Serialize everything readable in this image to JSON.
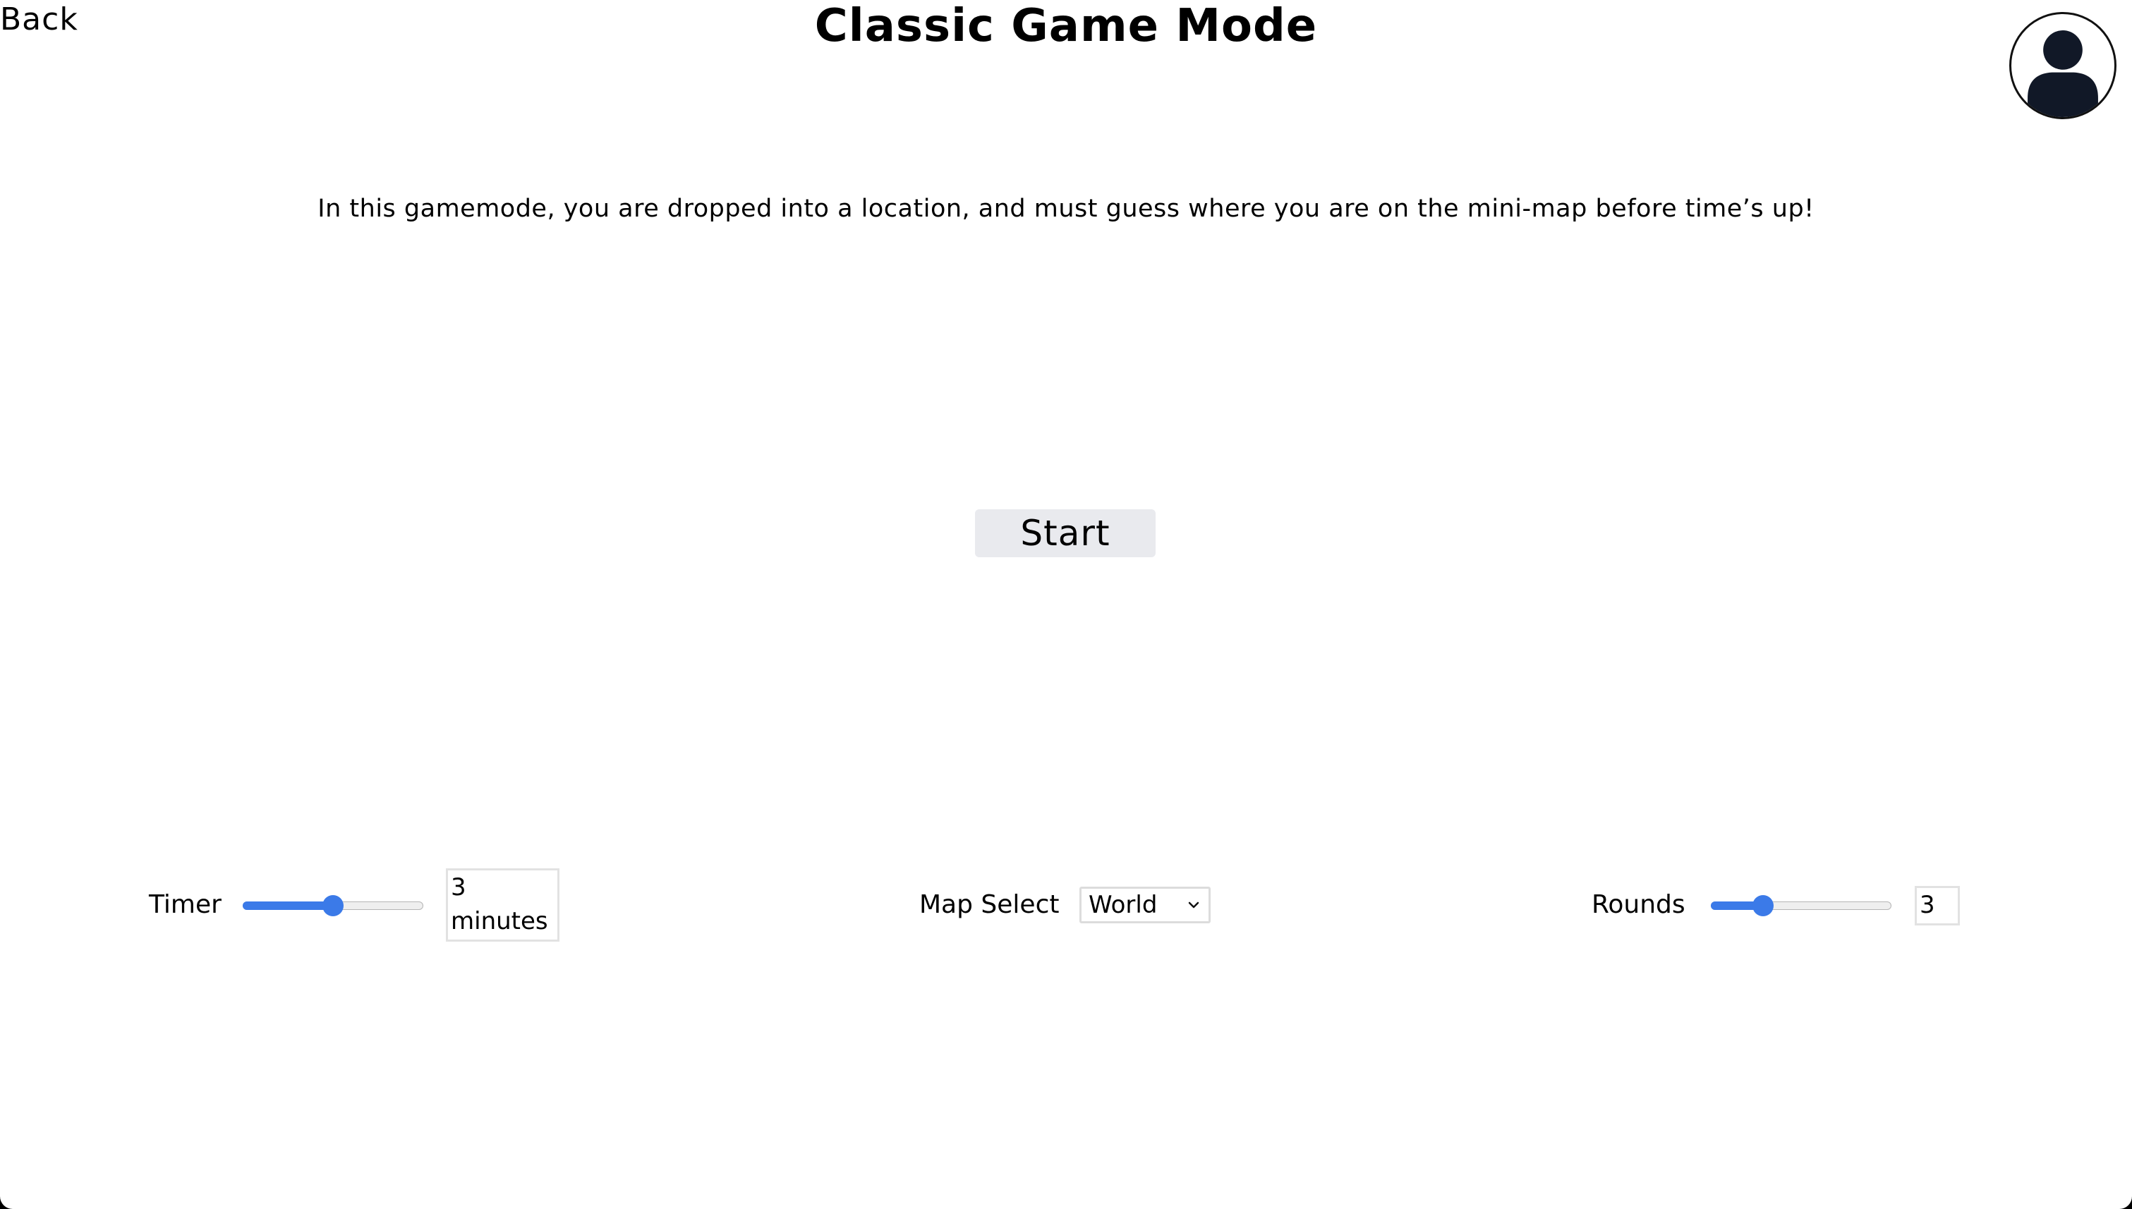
{
  "header": {
    "back_label": "Back",
    "title": "Classic Game Mode"
  },
  "profile": {
    "icon": "user-avatar-icon"
  },
  "main": {
    "description": "In this gamemode, you are dropped into a location, and must guess where you are on the mini-map before time’s up!",
    "start_label": "Start"
  },
  "settings": {
    "timer": {
      "label": "Timer",
      "value_text": "3 minutes",
      "slider_fraction": 0.5
    },
    "map_select": {
      "label": "Map Select",
      "selected": "World",
      "icon": "chevron-down-icon"
    },
    "rounds": {
      "label": "Rounds",
      "value_text": "3",
      "slider_fraction": 0.26
    }
  },
  "colors": {
    "accent": "#3b7ae8",
    "button_bg": "#e9eaee",
    "avatar": "#111827"
  }
}
